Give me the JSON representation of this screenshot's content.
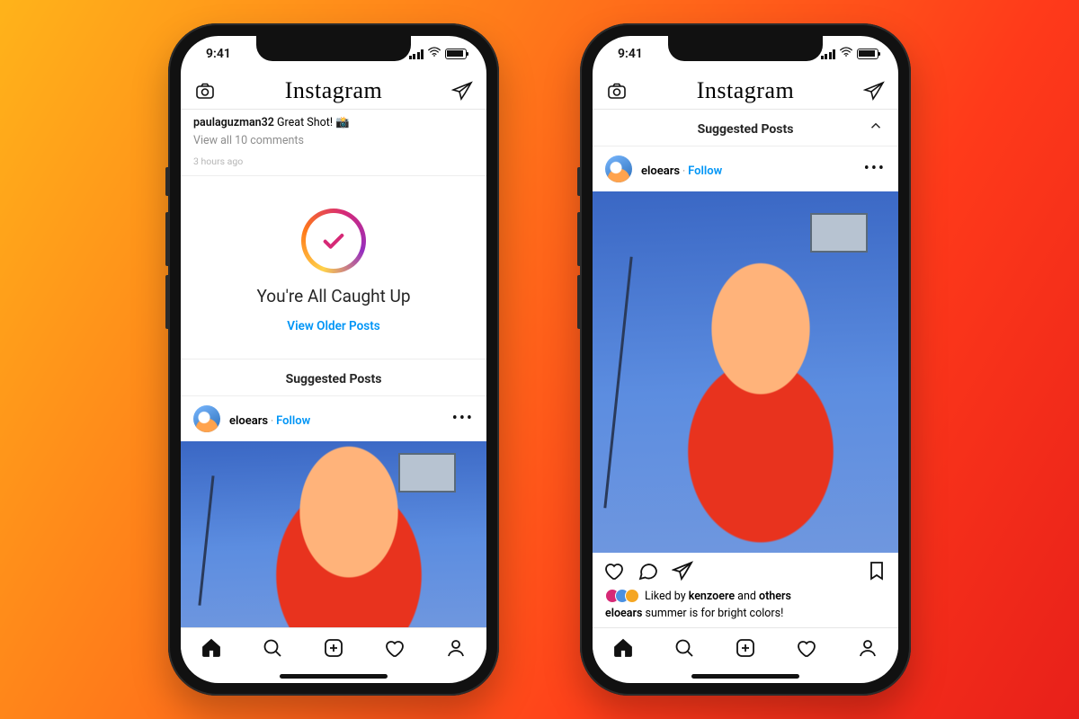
{
  "statusbar": {
    "time": "9:41"
  },
  "topbar": {
    "logo": "Instagram"
  },
  "phone1": {
    "comment_user": "paulaguzman32",
    "comment_text": "Great Shot! 📸",
    "view_all": "View all 10 comments",
    "ago": "3 hours ago",
    "caughtup_title": "You're All Caught Up",
    "caughtup_link": "View Older Posts",
    "suggested_header": "Suggested Posts"
  },
  "suggested_user": {
    "username": "eloears",
    "separator": " · ",
    "follow": "Follow"
  },
  "phone2": {
    "suggested_header": "Suggested Posts",
    "liked_prefix": "Liked by ",
    "liked_user": "kenzoere",
    "liked_suffix": " and ",
    "liked_others": "others",
    "caption_user": "eloears",
    "caption_text": " summer is for bright colors!"
  }
}
